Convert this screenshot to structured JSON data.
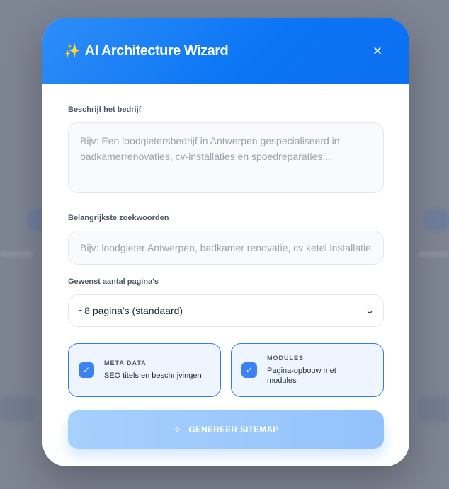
{
  "modal": {
    "title": "AI Architecture Wizard",
    "title_icon": "sparkles-icon",
    "close_icon": "close-icon"
  },
  "form": {
    "business": {
      "label": "Beschrijf het bedrijf",
      "value": "",
      "placeholder": "Bijv: Een loodgietersbedrijf in Antwerpen gespecialiseerd in badkamerrenovaties, cv-installaties en spoedreparaties..."
    },
    "keywords": {
      "label": "Belangrijkste zoekwoorden",
      "value": "",
      "placeholder": "Bijv: loodgieter Antwerpen, badkamer renovatie, cv ketel installatie"
    },
    "pages": {
      "label": "Gewenst aantal pagina's",
      "selected": "~8 pagina's (standaard)"
    },
    "options": [
      {
        "title": "META DATA",
        "description": "SEO titels en beschrijvingen",
        "checked": true
      },
      {
        "title": "MODULES",
        "description": "Pagina-opbouw met modules",
        "checked": true
      }
    ],
    "submit_label": "GENEREER SITEMAP"
  },
  "colors": {
    "header_start": "#2e8ef7",
    "header_end": "#0d6ff2",
    "accent": "#3b82f6",
    "button": "#a6d0fd"
  }
}
